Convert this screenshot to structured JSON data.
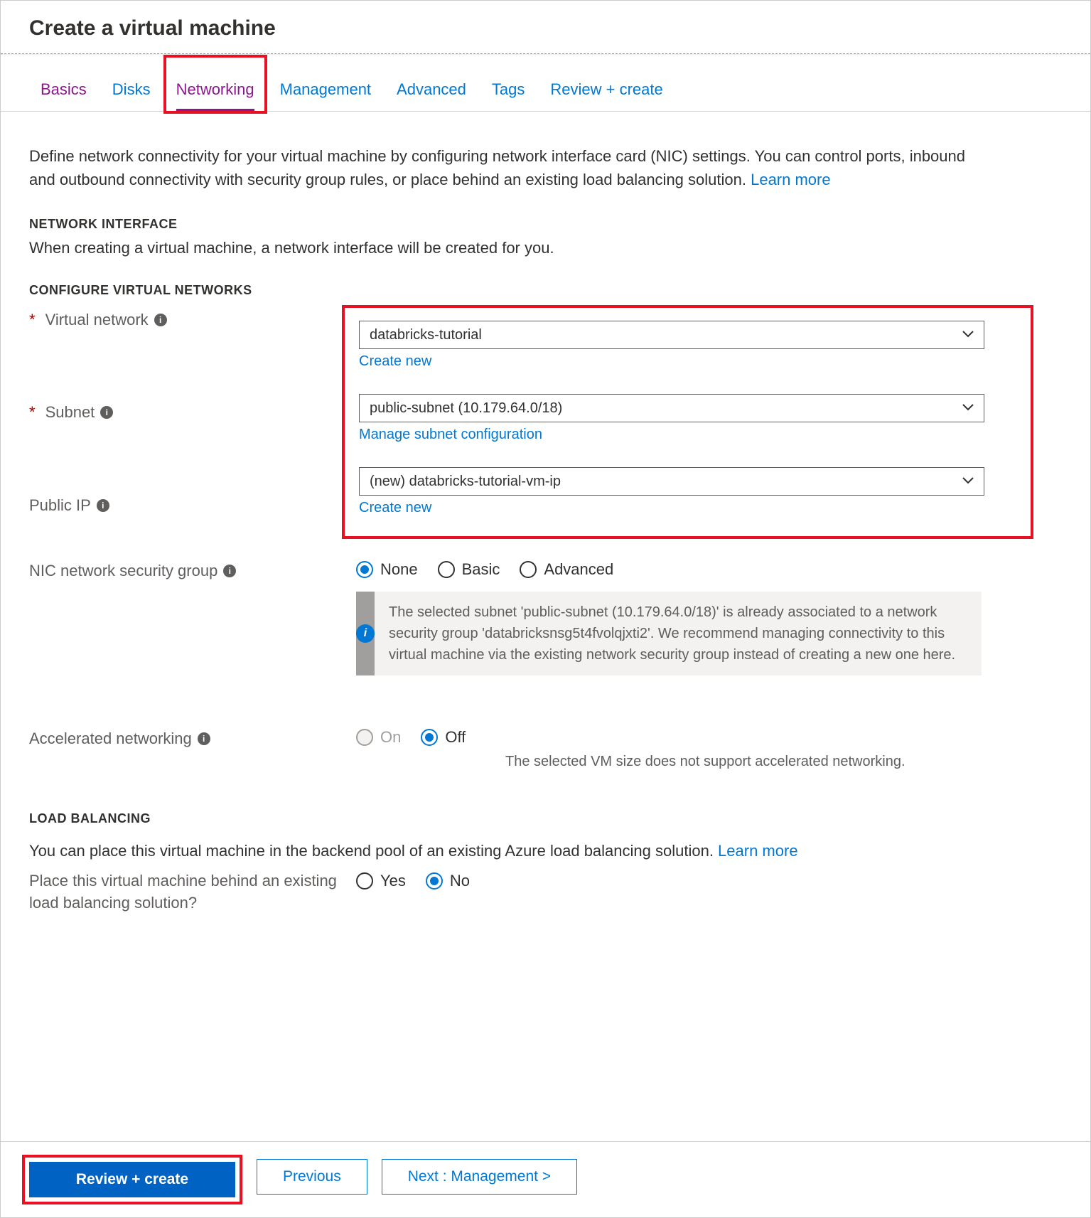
{
  "header": {
    "title": "Create a virtual machine"
  },
  "tabs": {
    "basics": "Basics",
    "disks": "Disks",
    "networking": "Networking",
    "management": "Management",
    "advanced": "Advanced",
    "tags": "Tags",
    "review": "Review + create"
  },
  "intro": {
    "text": "Define network connectivity for your virtual machine by configuring network interface card (NIC) settings. You can control ports, inbound and outbound connectivity with security group rules, or place behind an existing load balancing solution.  ",
    "learn_more": "Learn more"
  },
  "sections": {
    "network_interface": {
      "heading": "NETWORK INTERFACE",
      "sub": "When creating a virtual machine, a network interface will be created for you."
    },
    "configure_vnets": {
      "heading": "CONFIGURE VIRTUAL NETWORKS"
    },
    "load_balancing": {
      "heading": "LOAD BALANCING",
      "sub": "You can place this virtual machine in the backend pool of an existing Azure load balancing solution.  ",
      "learn_more": "Learn more"
    }
  },
  "fields": {
    "vnet": {
      "label": "Virtual network",
      "value": "databricks-tutorial",
      "create_new": "Create new"
    },
    "subnet": {
      "label": "Subnet",
      "value": "public-subnet (10.179.64.0/18)",
      "manage": "Manage subnet configuration"
    },
    "public_ip": {
      "label": "Public IP",
      "value": "(new) databricks-tutorial-vm-ip",
      "create_new": "Create new"
    },
    "nsg": {
      "label": "NIC network security group",
      "options": {
        "none": "None",
        "basic": "Basic",
        "advanced": "Advanced"
      },
      "info": "The selected subnet 'public-subnet (10.179.64.0/18)' is already associated to a network security group 'databricksnsg5t4fvolqjxti2'. We recommend managing connectivity to this virtual machine via the existing network security group instead of creating a new one here."
    },
    "accel": {
      "label": "Accelerated networking",
      "on": "On",
      "off": "Off",
      "note": "The selected VM size does not support accelerated networking."
    },
    "lb": {
      "label": "Place this virtual machine behind an existing load balancing solution?",
      "yes": "Yes",
      "no": "No"
    }
  },
  "footer": {
    "review": "Review + create",
    "previous": "Previous",
    "next": "Next : Management >"
  }
}
